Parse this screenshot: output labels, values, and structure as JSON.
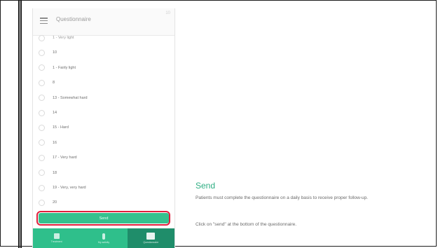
{
  "header": {
    "title": "Questionnaire",
    "corner_mark": "10"
  },
  "scale_items": [
    {
      "text": "1 - Very light",
      "partial": true
    },
    {
      "text": "10"
    },
    {
      "text": "1 - Fairly light"
    },
    {
      "text": "8"
    },
    {
      "text": "13 - Somewhat hard"
    },
    {
      "text": "14"
    },
    {
      "text": "15 - Hard"
    },
    {
      "text": "16"
    },
    {
      "text": "17 - Very hard"
    },
    {
      "text": "18"
    },
    {
      "text": "19 - Very, very hard"
    },
    {
      "text": "20"
    }
  ],
  "send_button": {
    "label": "Send"
  },
  "bottom_nav": [
    {
      "label": "Treatment",
      "icon": "calendar-icon",
      "active": false
    },
    {
      "label": "My activity",
      "icon": "person-icon",
      "active": false
    },
    {
      "label": "Questionnaire",
      "icon": "clipboard-icon",
      "active": true
    }
  ],
  "info": {
    "title": "Send",
    "description": "Patients must complete the questionnaire on a daily basis to receive proper follow-up.",
    "note": "Click on \"send\" at the bottom of the questionnaire."
  },
  "colors": {
    "accent": "#35c18e",
    "nav_bg": "#2fbf8b",
    "nav_active": "#1f8d6a",
    "highlight": "#e01e3c",
    "title": "#2fae83"
  }
}
